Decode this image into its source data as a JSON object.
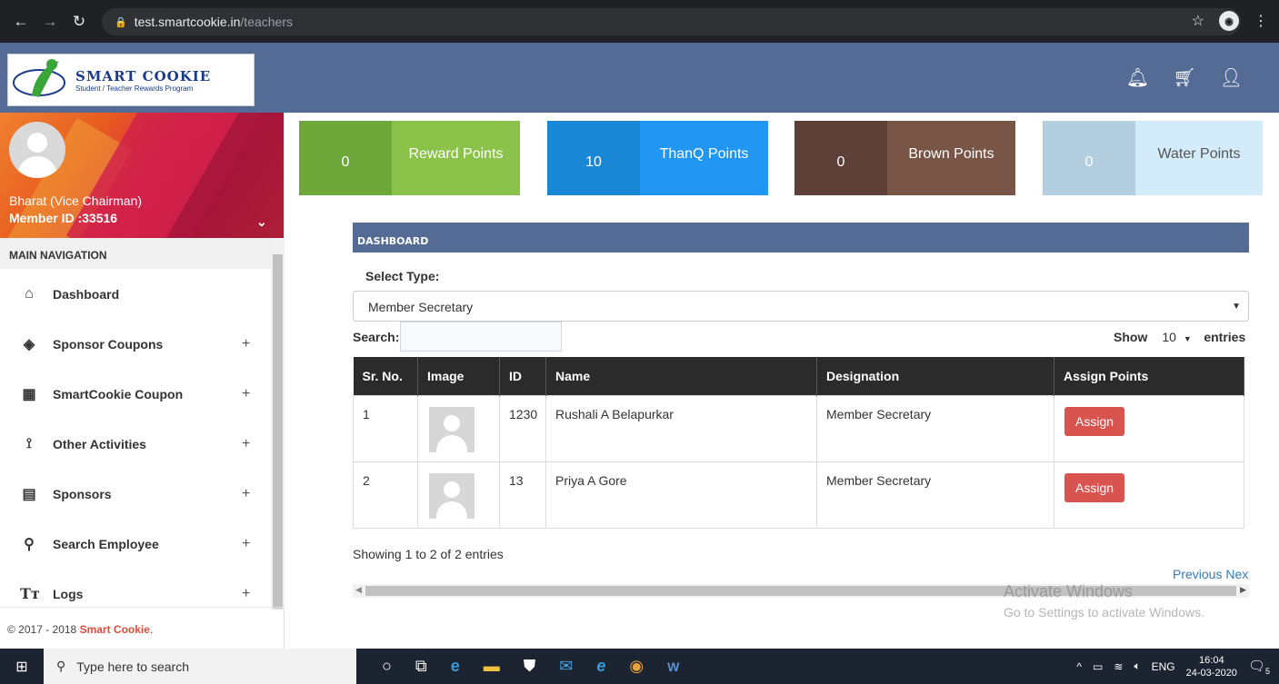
{
  "browser": {
    "url_host": "test.smartcookie.in",
    "url_path": "/teachers"
  },
  "header": {
    "brand": "SMART COOKIE",
    "tagline": "Student / Teacher Rewards Program"
  },
  "sidebar": {
    "user_name": "Bharat (Vice Chairman)",
    "member_id": "Member ID :33516",
    "nav_title": "MAIN NAVIGATION",
    "items": [
      {
        "label": "Dashboard",
        "icon": "home-icon"
      },
      {
        "label": "Sponsor Coupons",
        "icon": "layers-icon"
      },
      {
        "label": "SmartCookie Coupon",
        "icon": "grid-icon"
      },
      {
        "label": "Other Activities",
        "icon": "route-icon"
      },
      {
        "label": "Sponsors",
        "icon": "clipboard-icon"
      },
      {
        "label": "Search Employee",
        "icon": "search-icon"
      },
      {
        "label": "Logs",
        "icon": "text-size-icon"
      }
    ],
    "copyright_prefix": "© 2017 - 2018",
    "copyright_brand": "Smart Cookie",
    "copyright_suffix": "."
  },
  "points": [
    {
      "value": "0",
      "label": "Reward Points",
      "dark": "#6fa83a",
      "light": "#8bc34a"
    },
    {
      "value": "10",
      "label": "ThanQ Points",
      "dark": "#1a86d6",
      "light": "#2196f3"
    },
    {
      "value": "0",
      "label": "Brown Points",
      "dark": "#5d4037",
      "light": "#795548"
    },
    {
      "value": "0",
      "label": "Water Points",
      "dark": "#b3cfdf",
      "light": "#d4ecfa"
    }
  ],
  "dashboard": {
    "title": "DASHBOARD",
    "select_label": "Select Type:",
    "select_value": "Member Secretary",
    "search_label": "Search:",
    "search_value": "",
    "show_label": "Show",
    "show_value": "10",
    "entries_label": "entries",
    "columns": [
      "Sr. No.",
      "Image",
      "ID",
      "Name",
      "Designation",
      "Assign Points"
    ],
    "rows": [
      {
        "sr": "1",
        "id": "1230",
        "name": "Rushali A Belapurkar",
        "designation": "Member Secretary",
        "action": "Assign"
      },
      {
        "sr": "2",
        "id": "13",
        "name": "Priya A Gore",
        "designation": "Member Secretary",
        "action": "Assign"
      }
    ],
    "showing": "Showing 1 to 2 of 2 entries",
    "pager": "Previous Next"
  },
  "watermark": {
    "line1": "Activate Windows",
    "line2": "Go to Settings to activate Windows."
  },
  "taskbar": {
    "search_placeholder": "Type here to search",
    "lang": "ENG",
    "time": "16:04",
    "date": "24-03-2020",
    "notifications": "5"
  }
}
